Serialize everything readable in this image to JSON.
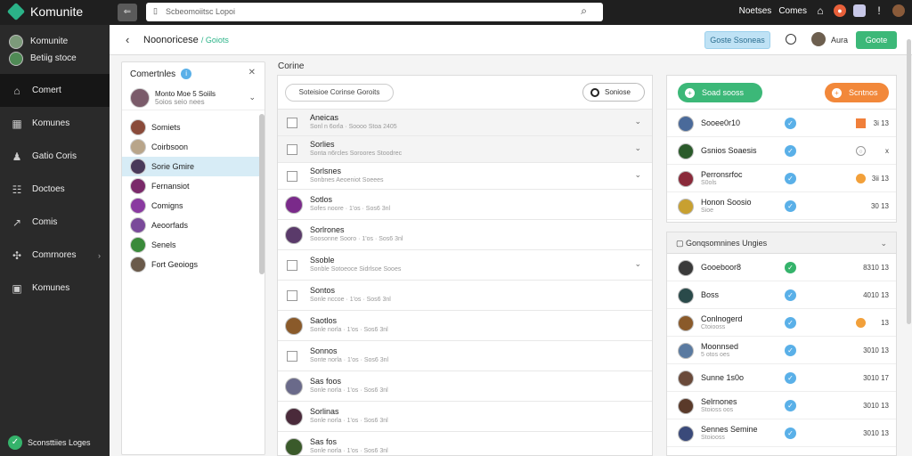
{
  "app": {
    "name": "Komunite"
  },
  "topbar": {
    "search_text": "Scbeomoiitsc Lopoi",
    "links": [
      "Noetses",
      "Comes"
    ]
  },
  "nav": {
    "users": [
      "Komunite",
      "Betiig stoce"
    ],
    "items": [
      {
        "label": "Comert",
        "icon": "home-icon"
      },
      {
        "label": "Komunes",
        "icon": "building-icon"
      },
      {
        "label": "Gatio Coris",
        "icon": "person-icon"
      },
      {
        "label": "Doctoes",
        "icon": "grid-icon"
      },
      {
        "label": "Comis",
        "icon": "share-icon"
      },
      {
        "label": "Comrnores",
        "icon": "puzzle-icon"
      },
      {
        "label": "Komunes",
        "icon": "window-icon"
      }
    ],
    "footer": "Sconsttiies Loges"
  },
  "header": {
    "title": "Noonoricese",
    "title_tag": "/ Goiots",
    "blue_button": "Goste Ssoneas",
    "user": "Aura",
    "green_button": "Goote"
  },
  "contacts": {
    "title": "Comertnles",
    "me": {
      "name": "Monto Moe 5 Soiils",
      "sub": "5oios seio nees"
    },
    "items": [
      "Somiets",
      "Coirbsoon",
      "Sorie Gmire",
      "Fernansiot",
      "Comigns",
      "Aeoorfads",
      "Senels",
      "Fort Geoiogs"
    ]
  },
  "list": {
    "label": "Corine",
    "filter": "Soteisioe Corinse Goroits",
    "button": "Soniose",
    "rows": [
      {
        "title": "Aneicas",
        "sub": "Sonl n 6orla · Soooo Stoa 2405",
        "kind": "checkbox",
        "chev": true,
        "gray": true
      },
      {
        "title": "Sorlies",
        "sub": "Sonta n6rcles Soroores Stoodrec",
        "kind": "checkbox",
        "chev": true,
        "gray": true
      },
      {
        "title": "Sorlsnes",
        "sub": "Sonbnes Aeoeniot Soeees",
        "kind": "checkbox",
        "chev": true,
        "gray": false
      },
      {
        "title": "Sotlos",
        "sub": "Sofes noore · 1'os · Sos6 3nl",
        "kind": "avatar",
        "chev": false,
        "gray": false
      },
      {
        "title": "Sorlrones",
        "sub": "Soosonne Sooro · 1'os · Sos6 3nl",
        "kind": "avatar",
        "chev": false,
        "gray": false
      },
      {
        "title": "Ssoble",
        "sub": "Sonble Sotoeoce Sidrlsoe Sooes",
        "kind": "checkbox",
        "chev": true,
        "gray": false
      },
      {
        "title": "Sontos",
        "sub": "Sonle nccoe · 1'os · Sos6 3nl",
        "kind": "checkbox",
        "chev": false,
        "gray": false
      },
      {
        "title": "Saotlos",
        "sub": "Sonle norla · 1'os · Sos6 3nl",
        "kind": "avatar",
        "chev": false,
        "gray": false
      },
      {
        "title": "Sonnos",
        "sub": "Sonte norla · 1'os · Sos6 3nl",
        "kind": "checkbox",
        "chev": false,
        "gray": false
      },
      {
        "title": "Sas foos",
        "sub": "Sonle norla · 1'os · Sos6 3nl",
        "kind": "avatar",
        "chev": false,
        "gray": false
      },
      {
        "title": "Sorlinas",
        "sub": "Sonle norla · 1'os · Sos6 3nl",
        "kind": "avatar",
        "chev": false,
        "gray": false
      },
      {
        "title": "Sas fos",
        "sub": "Sonle norla · 1'os · Sos6 3nl",
        "kind": "avatar",
        "chev": false,
        "gray": false
      }
    ]
  },
  "right_top": {
    "green_pill": "Soad sooss",
    "orange_pill": "Scntnos",
    "rows": [
      {
        "title": "Sooee0r10",
        "sub": "",
        "status": "blue",
        "flag": "sq",
        "nums": "3i  13"
      },
      {
        "title": "Gsnios Soaesis",
        "sub": "",
        "status": "blue",
        "flag": "gray",
        "nums": "x"
      },
      {
        "title": "Perronsrfoc",
        "sub": "S0ols",
        "status": "blue",
        "flag": "orange",
        "nums": "3ii  13"
      },
      {
        "title": "Honon Soosio",
        "sub": "Sioe",
        "status": "blue",
        "flag": "none",
        "nums": "30  13"
      }
    ]
  },
  "right_bottom": {
    "title": "Gonqsomnines Ungies",
    "rows": [
      {
        "title": "Gooeboor8",
        "sub": "",
        "status": "green",
        "flag": "none",
        "nums": "8310  13"
      },
      {
        "title": "Boss",
        "sub": "",
        "status": "blue",
        "flag": "none",
        "nums": "4010  13"
      },
      {
        "title": "Conlnogerd",
        "sub": "Ctoiooss",
        "status": "blue",
        "flag": "orange",
        "nums": "13"
      },
      {
        "title": "Moonnsed",
        "sub": "5 otos oes",
        "status": "blue",
        "flag": "none",
        "nums": "3010  13"
      },
      {
        "title": "Sunne 1s0o",
        "sub": "",
        "status": "blue",
        "flag": "none",
        "nums": "3010  17"
      },
      {
        "title": "Selrnones",
        "sub": "Stoioss oos",
        "status": "blue",
        "flag": "none",
        "nums": "3010  13"
      },
      {
        "title": "Sennes Semine",
        "sub": "Stoiooss",
        "status": "blue",
        "flag": "none",
        "nums": "3010  13"
      }
    ]
  },
  "colors": {
    "accent_green": "#3cb878",
    "accent_blue": "#5ab0e8",
    "accent_orange": "#f2883a",
    "sidebar": "#2a2a2a",
    "topbar": "#1f1f1f"
  }
}
